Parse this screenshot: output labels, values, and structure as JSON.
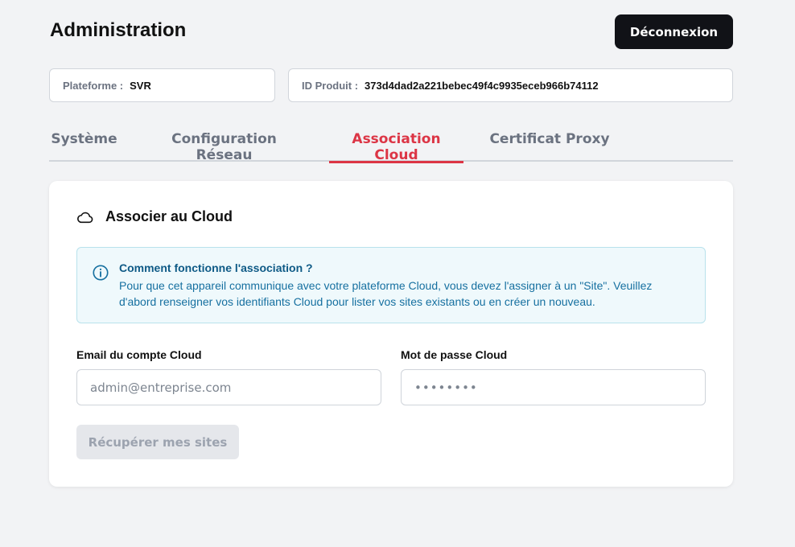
{
  "header": {
    "title": "Administration",
    "logout_label": "Déconnexion"
  },
  "info": {
    "platform_label": "Plateforme :",
    "platform_value": "SVR",
    "product_label": "ID Produit :",
    "product_value": "373d4dad2a221bebec49f4c9935eceb966b74112"
  },
  "tabs": [
    {
      "label": "Système",
      "active": false
    },
    {
      "label": "Configuration Réseau",
      "active": false
    },
    {
      "label": "Association Cloud",
      "active": true
    },
    {
      "label": "Certificat Proxy",
      "active": false
    }
  ],
  "card": {
    "icon": "cloud-icon",
    "title": "Associer au Cloud",
    "alert": {
      "icon": "info-icon",
      "title": "Comment fonctionne l'association ?",
      "text": "Pour que cet appareil communique avec votre plateforme Cloud, vous devez l'assigner à un \"Site\". Veuillez d'abord renseigner vos identifiants Cloud pour lister vos sites existants ou en créer un nouveau."
    },
    "email": {
      "label": "Email du compte Cloud",
      "placeholder": "admin@entreprise.com",
      "value": ""
    },
    "password": {
      "label": "Mot de passe Cloud",
      "placeholder": "••••••••",
      "value": ""
    },
    "fetch_button_label": "Récupérer mes sites"
  },
  "colors": {
    "accent": "#dc3545",
    "dark_button": "#111217",
    "alert_bg": "#eff9fc",
    "alert_text": "#1670a0"
  }
}
